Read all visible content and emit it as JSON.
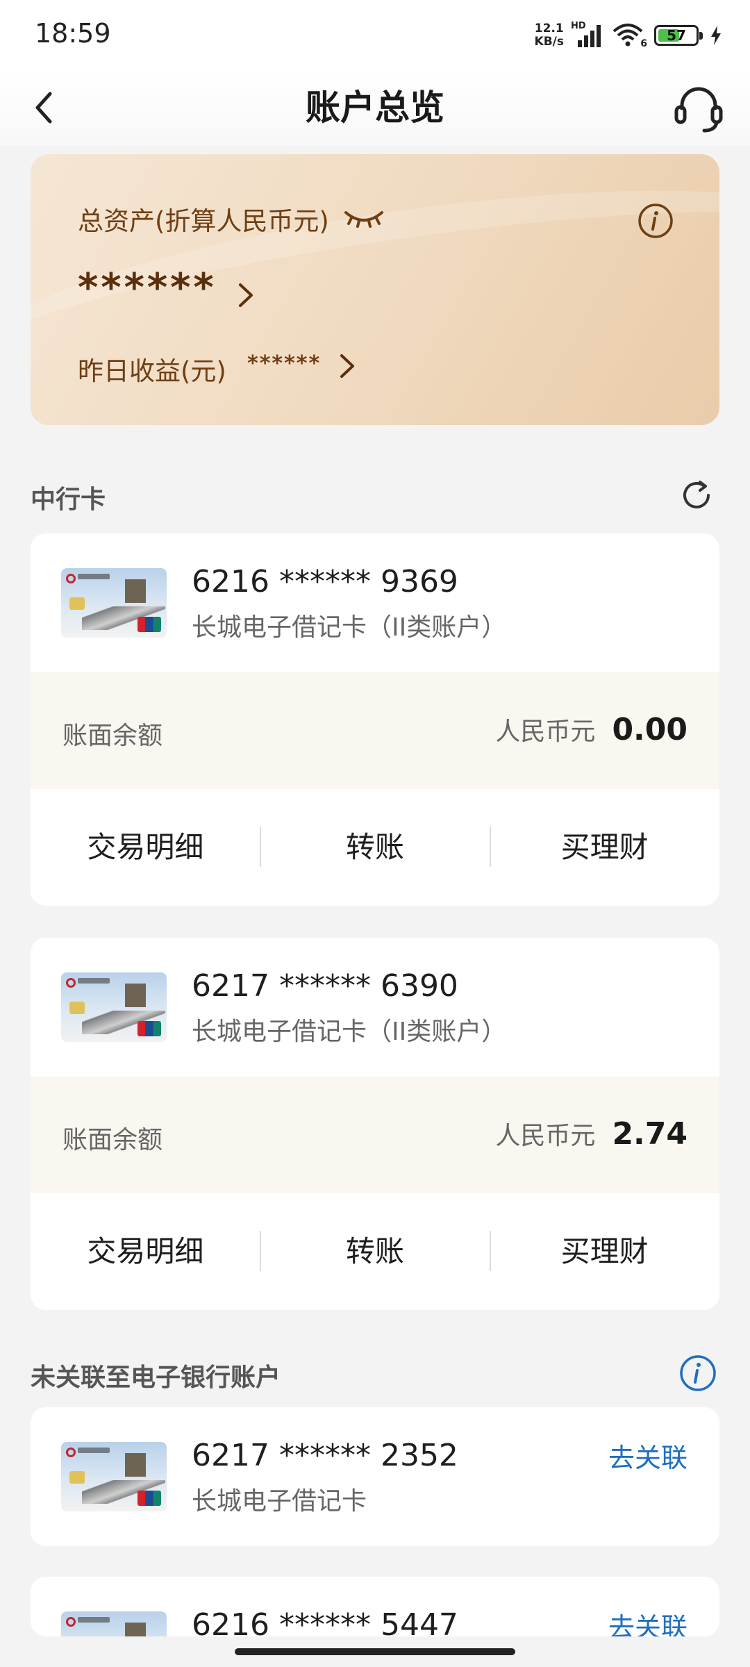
{
  "status_bar": {
    "time": "18:59",
    "net_speed_value": "12.1",
    "net_speed_unit": "KB/s",
    "network_label": "HD",
    "wifi_badge": "6",
    "battery": "57"
  },
  "nav": {
    "title": "账户总览"
  },
  "assets": {
    "total_label": "总资产(折算人民币元)",
    "total_value": "******",
    "yesterday_label": "昨日收益(元)",
    "yesterday_value": "******"
  },
  "section_linked": {
    "title": "中行卡"
  },
  "cards": [
    {
      "number": "6216 ****** 9369",
      "type": "长城电子借记卡（II类账户）",
      "balance_label": "账面余额",
      "currency": "人民币元",
      "balance": "0.00",
      "actions": [
        "交易明细",
        "转账",
        "买理财"
      ]
    },
    {
      "number": "6217 ****** 6390",
      "type": "长城电子借记卡（II类账户）",
      "balance_label": "账面余额",
      "currency": "人民币元",
      "balance": "2.74",
      "actions": [
        "交易明细",
        "转账",
        "买理财"
      ]
    }
  ],
  "section_unlinked": {
    "title": "未关联至电子银行账户"
  },
  "unlinked_cards": [
    {
      "number": "6217 ****** 2352",
      "type": "长城电子借记卡",
      "link_label": "去关联"
    },
    {
      "number": "6216 ****** 5447",
      "type": "",
      "link_label": "去关联"
    }
  ],
  "colors": {
    "accent_brown": "#6e3f14",
    "link_blue": "#1f6fbf",
    "card_bg_gold": "#f1dcc3"
  }
}
